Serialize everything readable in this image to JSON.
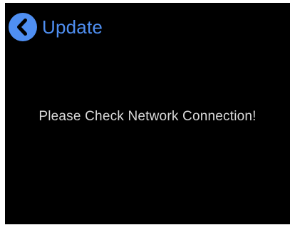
{
  "header": {
    "title": "Update",
    "back_icon": "chevron-left-circle-icon"
  },
  "message": {
    "text": "Please Check Network Connection!"
  },
  "colors": {
    "screen_background": "#000000",
    "accent": "#4f8ff2",
    "title_text": "#4f8ff2",
    "message_text": "#d9d9d9",
    "back_icon_glyph": "#000000"
  }
}
